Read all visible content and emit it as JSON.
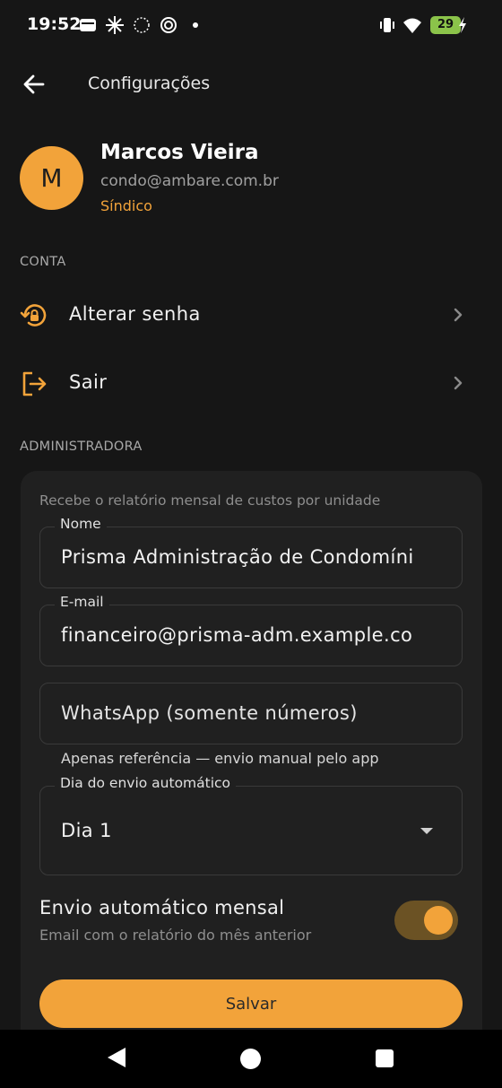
{
  "status_bar": {
    "time": "19:52",
    "battery": "29"
  },
  "header": {
    "title": "Configurações"
  },
  "profile": {
    "initial": "M",
    "name": "Marcos Vieira",
    "email": "condo@ambare.com.br",
    "role": "Síndico"
  },
  "account_section": {
    "header": "CONTA",
    "items": [
      {
        "label": "Alterar senha",
        "icon": "lock-reset-icon"
      },
      {
        "label": "Sair",
        "icon": "logout-icon"
      }
    ]
  },
  "admin_section": {
    "header": "ADMINISTRADORA",
    "hint": "Recebe o relatório mensal de custos por unidade",
    "name_field": {
      "label": "Nome",
      "value": "Prisma Administração de Condomíni"
    },
    "email_field": {
      "label": "E-mail",
      "value": "financeiro@prisma-adm.example.co"
    },
    "whatsapp_field": {
      "placeholder": "WhatsApp (somente números)",
      "helper": "Apenas referência — envio manual pelo app"
    },
    "day_field": {
      "label": "Dia do envio automático",
      "value": "Dia 1"
    },
    "auto_send": {
      "title": "Envio automático mensal",
      "subtitle": "Email com o relatório do mês anterior",
      "enabled": true
    },
    "save_label": "Salvar"
  },
  "colors": {
    "accent": "#f2a33a",
    "background": "#161616",
    "card": "#202020"
  }
}
